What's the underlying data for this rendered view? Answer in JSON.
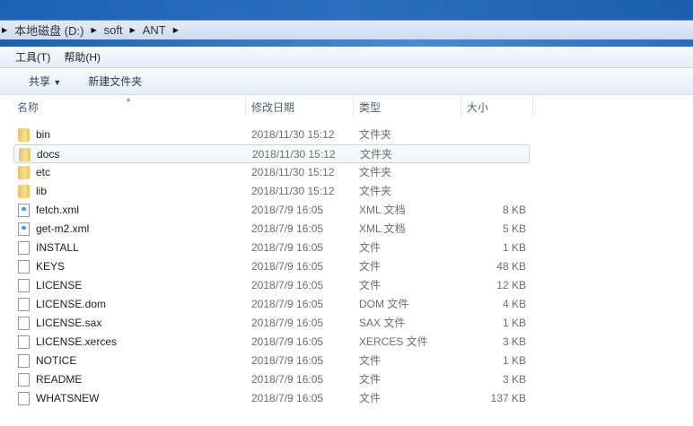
{
  "breadcrumb": [
    "本地磁盘 (D:)",
    "soft",
    "ANT"
  ],
  "menu": [
    "工具(T)",
    "帮助(H)"
  ],
  "toolbar": {
    "share": "共享",
    "new_folder": "新建文件夹"
  },
  "columns": {
    "name": "名称",
    "date": "修改日期",
    "type": "类型",
    "size": "大小"
  },
  "files": [
    {
      "name": "bin",
      "date": "2018/11/30 15:12",
      "type": "文件夹",
      "size": "",
      "icon": "folder"
    },
    {
      "name": "docs",
      "date": "2018/11/30 15:12",
      "type": "文件夹",
      "size": "",
      "icon": "folder"
    },
    {
      "name": "etc",
      "date": "2018/11/30 15:12",
      "type": "文件夹",
      "size": "",
      "icon": "folder"
    },
    {
      "name": "lib",
      "date": "2018/11/30 15:12",
      "type": "文件夹",
      "size": "",
      "icon": "folder"
    },
    {
      "name": "fetch.xml",
      "date": "2018/7/9 16:05",
      "type": "XML 文档",
      "size": "8 KB",
      "icon": "xml"
    },
    {
      "name": "get-m2.xml",
      "date": "2018/7/9 16:05",
      "type": "XML 文档",
      "size": "5 KB",
      "icon": "xml"
    },
    {
      "name": "INSTALL",
      "date": "2018/7/9 16:05",
      "type": "文件",
      "size": "1 KB",
      "icon": "file"
    },
    {
      "name": "KEYS",
      "date": "2018/7/9 16:05",
      "type": "文件",
      "size": "48 KB",
      "icon": "file"
    },
    {
      "name": "LICENSE",
      "date": "2018/7/9 16:05",
      "type": "文件",
      "size": "12 KB",
      "icon": "file"
    },
    {
      "name": "LICENSE.dom",
      "date": "2018/7/9 16:05",
      "type": "DOM 文件",
      "size": "4 KB",
      "icon": "file"
    },
    {
      "name": "LICENSE.sax",
      "date": "2018/7/9 16:05",
      "type": "SAX 文件",
      "size": "1 KB",
      "icon": "file"
    },
    {
      "name": "LICENSE.xerces",
      "date": "2018/7/9 16:05",
      "type": "XERCES 文件",
      "size": "3 KB",
      "icon": "file"
    },
    {
      "name": "NOTICE",
      "date": "2018/7/9 16:05",
      "type": "文件",
      "size": "1 KB",
      "icon": "file"
    },
    {
      "name": "README",
      "date": "2018/7/9 16:05",
      "type": "文件",
      "size": "3 KB",
      "icon": "file"
    },
    {
      "name": "WHATSNEW",
      "date": "2018/7/9 16:05",
      "type": "文件",
      "size": "137 KB",
      "icon": "file"
    }
  ]
}
